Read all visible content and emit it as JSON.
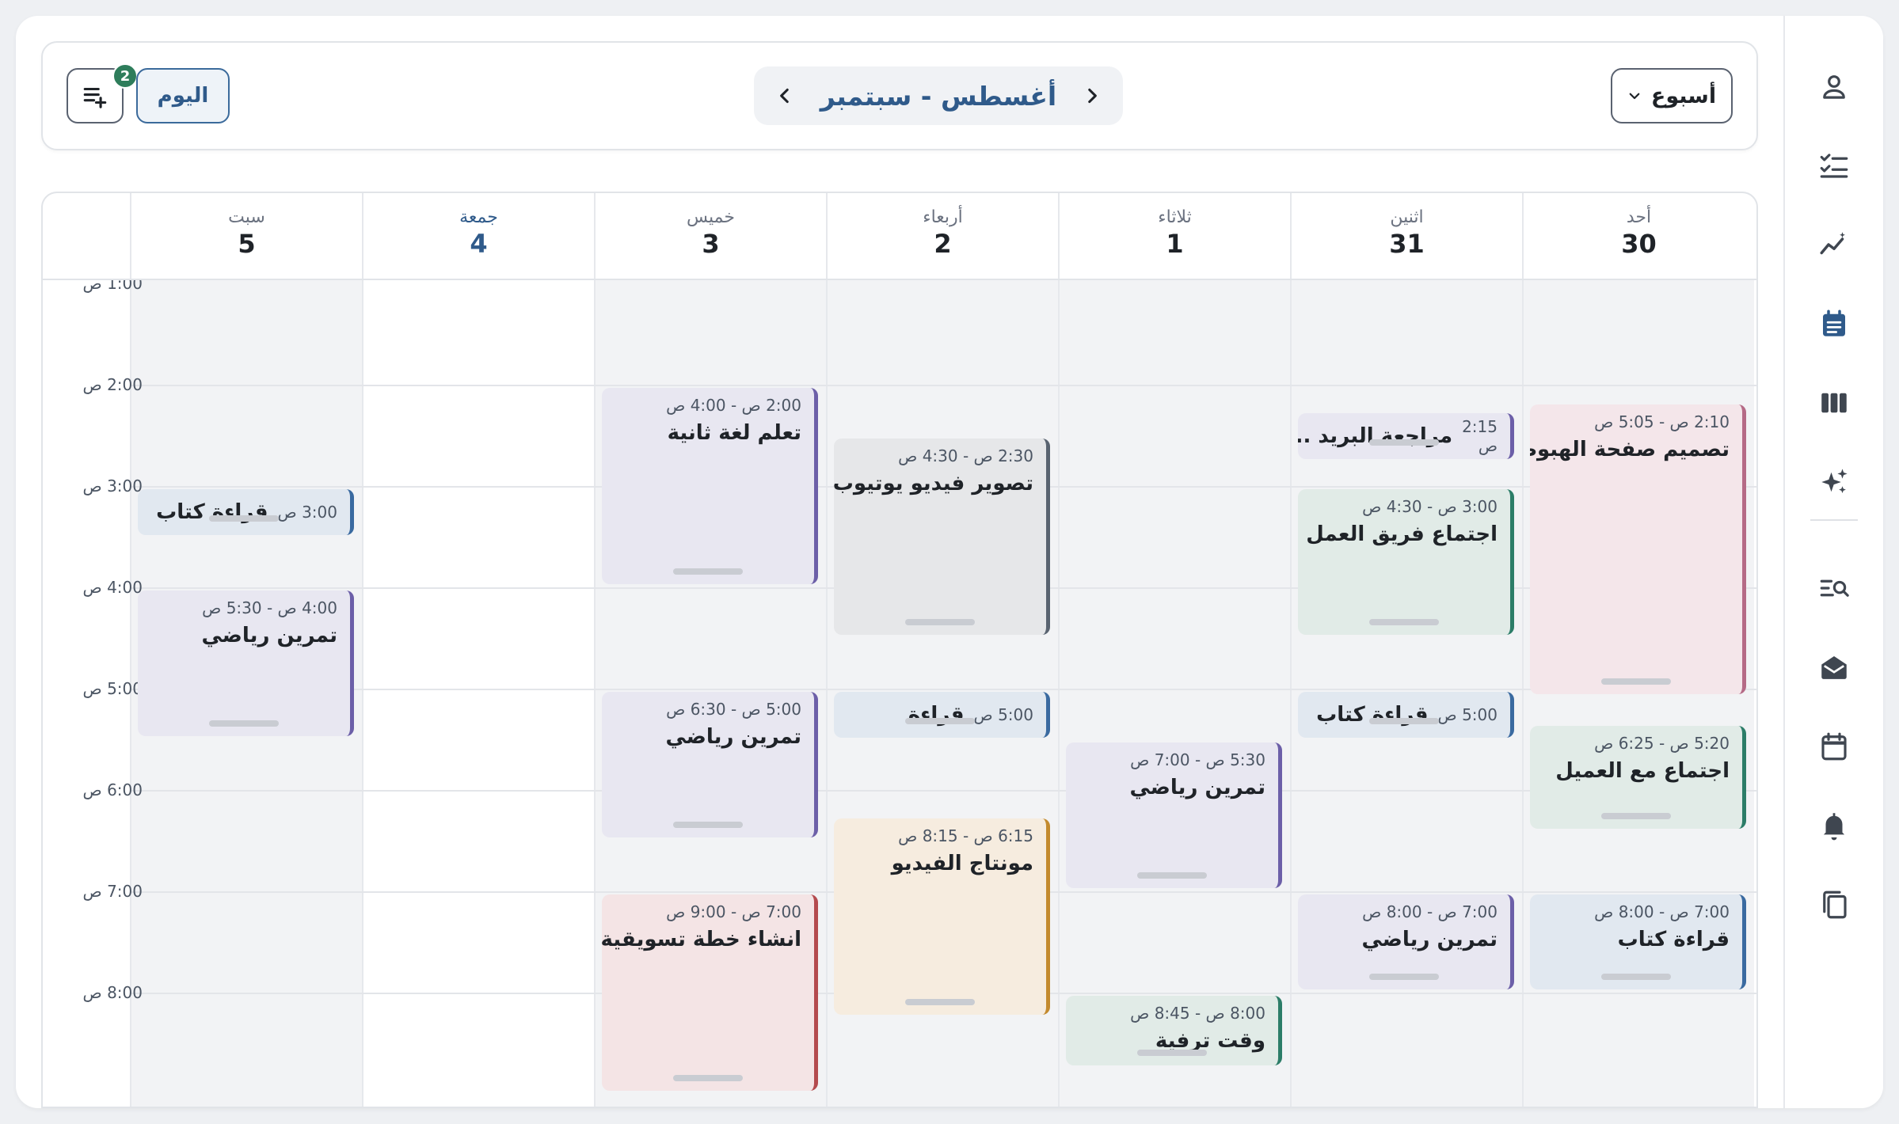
{
  "toolbar": {
    "view_select": "أسبوع",
    "period_title": "أغسطس - سبتمبر",
    "today_label": "اليوم",
    "tasks_badge": "2"
  },
  "sidebar": {
    "icons": [
      "user-icon",
      "checklist-icon",
      "analytics-icon",
      "calendar-notes-icon",
      "columns-icon",
      "sparkles-icon",
      "search-list-icon",
      "mail-open-icon",
      "calendar-icon",
      "bell-icon",
      "copy-icon"
    ],
    "active": "calendar-notes-icon",
    "accent": "#2f5a8a"
  },
  "days": [
    {
      "name": "أحد",
      "num": "30"
    },
    {
      "name": "اثنين",
      "num": "31"
    },
    {
      "name": "ثلاثاء",
      "num": "1"
    },
    {
      "name": "أربعاء",
      "num": "2"
    },
    {
      "name": "خميس",
      "num": "3"
    },
    {
      "name": "جمعة",
      "num": "4",
      "today": true
    },
    {
      "name": "سبت",
      "num": "5"
    }
  ],
  "time_labels": [
    "1:00 ص",
    "2:00 ص",
    "3:00 ص",
    "4:00 ص",
    "5:00 ص",
    "6:00 ص",
    "7:00 ص",
    "8:00 ص"
  ],
  "events": [
    {
      "day": 0,
      "time": "2:10 ص - 5:05 ص",
      "title": "تصميم صفحة الهبوط",
      "color": "pink"
    },
    {
      "day": 0,
      "time": "5:20 ص - 6:25 ص",
      "title": "اجتماع مع العميل",
      "color": "teal"
    },
    {
      "day": 0,
      "time": "7:00 ص - 8:00 ص",
      "title": "قراءة كتاب",
      "color": "blue"
    },
    {
      "day": 1,
      "time": "2:15 ص",
      "title": "مراجعة البريد ...",
      "color": "purple",
      "inline": true
    },
    {
      "day": 1,
      "time": "3:00 ص - 4:30 ص",
      "title": "اجتماع فريق العمل",
      "color": "teal"
    },
    {
      "day": 1,
      "time": "5:00 ص",
      "title": "قراءة كتاب",
      "color": "blue",
      "inline": true
    },
    {
      "day": 1,
      "time": "7:00 ص - 8:00 ص",
      "title": "تمرين رياضي",
      "color": "purple"
    },
    {
      "day": 2,
      "time": "5:30 ص - 7:00 ص",
      "title": "تمرين رياضي",
      "color": "purple"
    },
    {
      "day": 2,
      "time": "8:00 ص - 8:45 ص",
      "title": "وقت ترفية",
      "color": "teal"
    },
    {
      "day": 3,
      "time": "2:30 ص - 4:30 ص",
      "title": "تصوير فيديو يوتيوب",
      "color": "gray"
    },
    {
      "day": 3,
      "time": "5:00 ص",
      "title": "قراءة",
      "color": "blue",
      "inline": true
    },
    {
      "day": 3,
      "time": "6:15 ص - 8:15 ص",
      "title": "مونتاج الفيديو",
      "color": "orange"
    },
    {
      "day": 4,
      "time": "2:00 ص - 4:00 ص",
      "title": "تعلم لغة ثانية",
      "color": "purple"
    },
    {
      "day": 4,
      "time": "5:00 ص - 6:30 ص",
      "title": "تمرين رياضي",
      "color": "purple"
    },
    {
      "day": 4,
      "time": "7:00 ص - 9:00 ص",
      "title": "انشاء خطة تسويقية",
      "color": "red"
    },
    {
      "day": 6,
      "time": "3:00 ص",
      "title": "قراءة كتاب",
      "color": "blue",
      "inline": true
    },
    {
      "day": 6,
      "time": "4:00 ص - 5:30 ص",
      "title": "تمرين رياضي",
      "color": "purple"
    }
  ]
}
